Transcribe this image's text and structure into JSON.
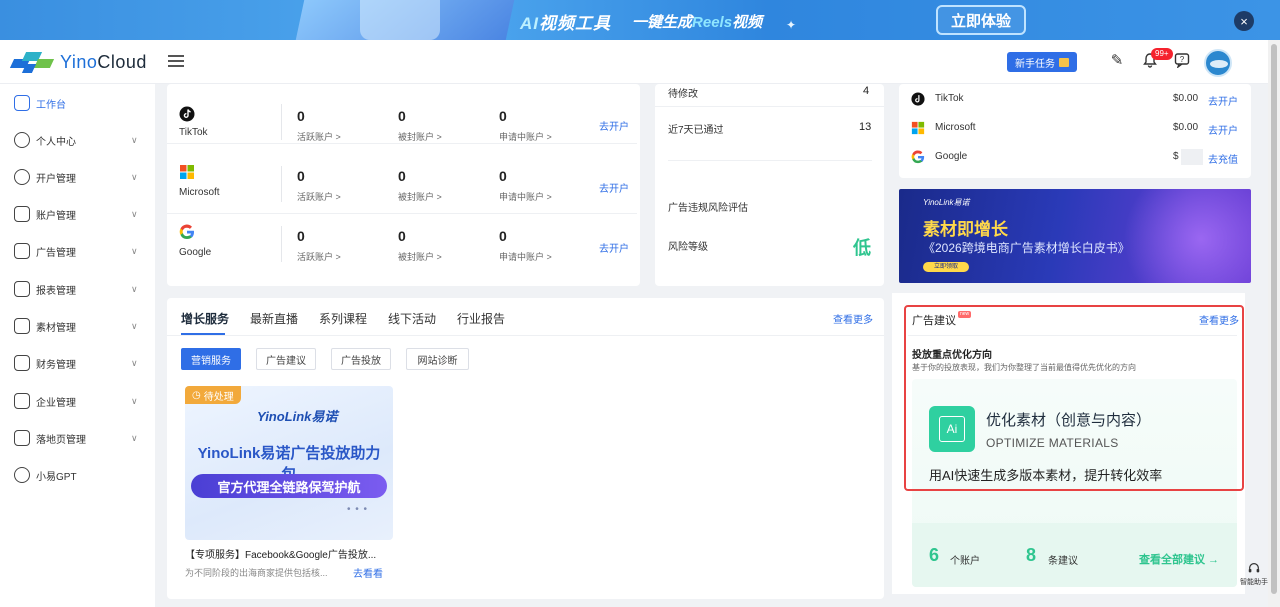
{
  "banner": {
    "tool_ai": "AI",
    "tool_rest": "视频工具",
    "slogan_pre": "一键生成",
    "slogan_reels": "Reels",
    "slogan_post": "视频",
    "cta": "立即体验",
    "close": "×"
  },
  "header": {
    "logo_a": "Yino",
    "logo_b": "Cloud",
    "new_task": "新手任务",
    "badge": "99+"
  },
  "sidebar": {
    "items": [
      {
        "label": "工作台"
      },
      {
        "label": "个人中心"
      },
      {
        "label": "开户管理"
      },
      {
        "label": "账户管理"
      },
      {
        "label": "广告管理"
      },
      {
        "label": "报表管理"
      },
      {
        "label": "素材管理"
      },
      {
        "label": "财务管理"
      },
      {
        "label": "企业管理"
      },
      {
        "label": "落地页管理"
      },
      {
        "label": "小易GPT"
      }
    ]
  },
  "platforms": {
    "metric_labels": [
      "活跃账户 >",
      "被封账户 >",
      "申请中账户 >"
    ],
    "open_label": "去开户",
    "rows": [
      {
        "name": "TikTok",
        "values": [
          "0",
          "0",
          "0"
        ]
      },
      {
        "name": "Microsoft",
        "values": [
          "0",
          "0",
          "0"
        ]
      },
      {
        "name": "Google",
        "values": [
          "0",
          "0",
          "0"
        ]
      }
    ]
  },
  "review": {
    "pending_label": "待修改",
    "pending_value": "4",
    "passed_label": "近7天已通过",
    "passed_value": "13",
    "risk_title": "广告违规风险评估",
    "risk_label": "风险等级",
    "risk_value": "低"
  },
  "spend": {
    "rows": [
      {
        "name": "TikTok",
        "amount": "$0.00",
        "action": "去开户"
      },
      {
        "name": "Microsoft",
        "amount": "$0.00",
        "action": "去开户"
      },
      {
        "name": "Google",
        "amount": "$",
        "action": "去充值"
      }
    ]
  },
  "ad_banner": {
    "logo": "YinoLink易诺",
    "headline": "素材即增长",
    "sub": "《2026跨境电商广告素材增长白皮书》",
    "btn": "立即领取"
  },
  "growth": {
    "tabs": [
      "增长服务",
      "最新直播",
      "系列课程",
      "线下活动",
      "行业报告"
    ],
    "more": "查看更多",
    "chips": [
      "营销服务",
      "广告建议",
      "广告投放",
      "网站诊断"
    ],
    "card": {
      "pending": "待处理",
      "brand": "YinoLink易诺",
      "title": "YinoLink易诺广告投放助力包",
      "strip": "官方代理全链路保驾护航",
      "name": "【专项服务】Facebook&Google广告投放...",
      "desc": "为不同阶段的出海商家提供包括核...",
      "go": "去看看"
    }
  },
  "suggest": {
    "title": "广告建议",
    "tag": "new",
    "more": "查看更多",
    "heading": "投放重点优化方向",
    "desc": "基于你的投放表现，我们为你整理了当前最值得优先优化的方向",
    "item_icon": "Ai",
    "item_title": "优化素材（创意与内容）",
    "item_en": "OPTIMIZE MATERIALS",
    "item_desc": "用AI快速生成多版本素材，提升转化效率",
    "accounts_num": "6",
    "accounts_label": "个账户",
    "suggest_num": "8",
    "suggest_label": "条建议",
    "view_all": "查看全部建议 →"
  },
  "assistant": "智能助手",
  "colors": {
    "accent": "#2f6ee6",
    "teal": "#2fd0a0",
    "highlight": "#e84343"
  }
}
